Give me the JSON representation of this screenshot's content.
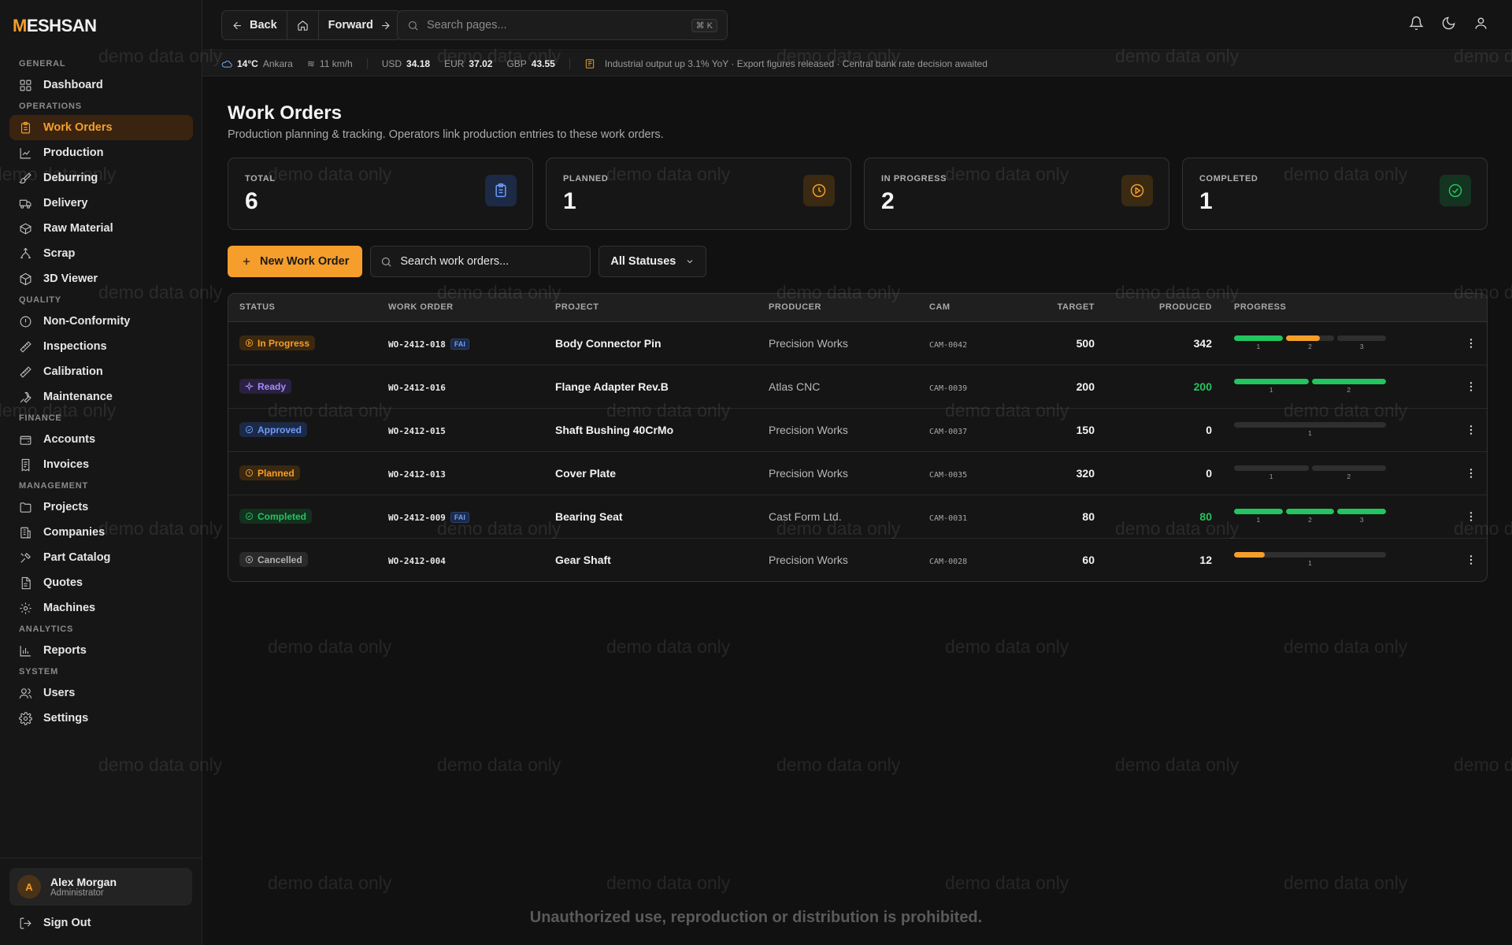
{
  "brand": {
    "logo_text": "MESHSAN",
    "accent": "#f59e2b"
  },
  "sidebar": {
    "sections": [
      {
        "label": "GENERAL",
        "items": [
          {
            "label": "Dashboard",
            "icon": "dashboard-icon"
          }
        ]
      },
      {
        "label": "OPERATIONS",
        "items": [
          {
            "label": "Work Orders",
            "icon": "clipboard-icon",
            "active": true
          },
          {
            "label": "Production",
            "icon": "chart-icon"
          },
          {
            "label": "Deburring",
            "icon": "brush-icon"
          },
          {
            "label": "Delivery",
            "icon": "truck-icon"
          },
          {
            "label": "Raw Material",
            "icon": "box-icon"
          },
          {
            "label": "Scrap",
            "icon": "recycle-icon"
          },
          {
            "label": "3D Viewer",
            "icon": "cube-icon"
          }
        ]
      },
      {
        "label": "QUALITY",
        "items": [
          {
            "label": "Non-Conformity",
            "icon": "alert-icon"
          },
          {
            "label": "Inspections",
            "icon": "ruler-icon"
          },
          {
            "label": "Calibration",
            "icon": "ruler-icon"
          },
          {
            "label": "Maintenance",
            "icon": "wrench-icon"
          }
        ]
      },
      {
        "label": "FINANCE",
        "items": [
          {
            "label": "Accounts",
            "icon": "wallet-icon"
          },
          {
            "label": "Invoices",
            "icon": "invoice-icon"
          }
        ]
      },
      {
        "label": "MANAGEMENT",
        "items": [
          {
            "label": "Projects",
            "icon": "folder-icon"
          },
          {
            "label": "Companies",
            "icon": "building-icon"
          },
          {
            "label": "Part Catalog",
            "icon": "tool-icon"
          },
          {
            "label": "Quotes",
            "icon": "document-icon"
          },
          {
            "label": "Machines",
            "icon": "gear-icon"
          }
        ]
      },
      {
        "label": "ANALYTICS",
        "items": [
          {
            "label": "Reports",
            "icon": "bar-chart-icon"
          }
        ]
      },
      {
        "label": "SYSTEM",
        "items": [
          {
            "label": "Users",
            "icon": "users-icon"
          },
          {
            "label": "Settings",
            "icon": "settings-icon"
          }
        ]
      }
    ],
    "user": {
      "initial": "A",
      "name": "Alex Morgan",
      "role": "Administrator"
    },
    "signout_label": "Sign Out"
  },
  "topbar": {
    "back_label": "Back",
    "forward_label": "Forward",
    "search_placeholder": "Search pages...",
    "search_shortcut": "⌘ K"
  },
  "ticker": {
    "temp": "14°C",
    "city": "Ankara",
    "wind": "11 km/h",
    "usd_label": "USD",
    "usd_value": "34.18",
    "eur_label": "EUR",
    "eur_value": "37.02",
    "gbp_label": "GBP",
    "gbp_value": "43.55",
    "news": "Industrial output up 3.1% YoY · Export figures released · Central bank rate decision awaited"
  },
  "page": {
    "title": "Work Orders",
    "subtitle": "Production planning & tracking. Operators link production entries to these work orders."
  },
  "stats": [
    {
      "label": "TOTAL",
      "value": "6",
      "icon": "clipboard-icon",
      "color": "#6d9cff",
      "bg": "#1d2a45"
    },
    {
      "label": "PLANNED",
      "value": "1",
      "icon": "clock-icon",
      "color": "#f59e2b",
      "bg": "#3a2a12"
    },
    {
      "label": "IN PROGRESS",
      "value": "2",
      "icon": "play-circle-icon",
      "color": "#f59e2b",
      "bg": "#3a2a12"
    },
    {
      "label": "COMPLETED",
      "value": "1",
      "icon": "check-circle-icon",
      "color": "#22c55e",
      "bg": "#153321"
    }
  ],
  "toolbar": {
    "new_label": "New Work Order",
    "search_placeholder": "Search work orders...",
    "status_filter": "All Statuses"
  },
  "table": {
    "headers": [
      "STATUS",
      "WORK ORDER",
      "PROJECT",
      "PRODUCER",
      "CAM",
      "TARGET",
      "PRODUCED",
      "PROGRESS"
    ],
    "rows": [
      {
        "status": "In Progress",
        "status_kind": "inprogress",
        "wo": "WO-2412-018",
        "fai": true,
        "project": "Body Connector Pin",
        "producer": "Precision Works",
        "cam": "CAM-0042",
        "target": "500",
        "produced": "342",
        "produced_green": false,
        "progress": [
          {
            "label": "1",
            "fill": 1.0,
            "color": "#22c55e"
          },
          {
            "label": "2",
            "fill": 0.7,
            "color": "#f59e2b"
          },
          {
            "label": "3",
            "fill": 0,
            "color": "#2f2f2f"
          }
        ]
      },
      {
        "status": "Ready",
        "status_kind": "ready",
        "wo": "WO-2412-016",
        "fai": false,
        "project": "Flange Adapter Rev.B",
        "producer": "Atlas CNC",
        "cam": "CAM-0039",
        "target": "200",
        "produced": "200",
        "produced_green": true,
        "progress": [
          {
            "label": "1",
            "fill": 1.0,
            "color": "#22c55e"
          },
          {
            "label": "2",
            "fill": 1.0,
            "color": "#22c55e"
          }
        ]
      },
      {
        "status": "Approved",
        "status_kind": "approved",
        "wo": "WO-2412-015",
        "fai": false,
        "project": "Shaft Bushing 40CrMo",
        "producer": "Precision Works",
        "cam": "CAM-0037",
        "target": "150",
        "produced": "0",
        "produced_green": false,
        "progress": [
          {
            "label": "1",
            "fill": 0,
            "color": "#2f2f2f"
          }
        ]
      },
      {
        "status": "Planned",
        "status_kind": "planned",
        "wo": "WO-2412-013",
        "fai": false,
        "project": "Cover Plate",
        "producer": "Precision Works",
        "cam": "CAM-0035",
        "target": "320",
        "produced": "0",
        "produced_green": false,
        "progress": [
          {
            "label": "1",
            "fill": 0,
            "color": "#2f2f2f"
          },
          {
            "label": "2",
            "fill": 0,
            "color": "#2f2f2f"
          }
        ]
      },
      {
        "status": "Completed",
        "status_kind": "completed",
        "wo": "WO-2412-009",
        "fai": true,
        "project": "Bearing Seat",
        "producer": "Cast Form Ltd.",
        "cam": "CAM-0031",
        "target": "80",
        "produced": "80",
        "produced_green": true,
        "progress": [
          {
            "label": "1",
            "fill": 1.0,
            "color": "#22c55e"
          },
          {
            "label": "2",
            "fill": 1.0,
            "color": "#22c55e"
          },
          {
            "label": "3",
            "fill": 1.0,
            "color": "#22c55e"
          }
        ]
      },
      {
        "status": "Cancelled",
        "status_kind": "cancelled",
        "wo": "WO-2412-004",
        "fai": false,
        "project": "Gear Shaft",
        "producer": "Precision Works",
        "cam": "CAM-0028",
        "target": "60",
        "produced": "12",
        "produced_green": false,
        "progress": [
          {
            "label": "1",
            "fill": 0.2,
            "color": "#f59e2b"
          }
        ]
      }
    ]
  },
  "fai_label": "FAI",
  "watermark_text": "demo data only",
  "footer_note": "Unauthorized use, reproduction or distribution is prohibited."
}
